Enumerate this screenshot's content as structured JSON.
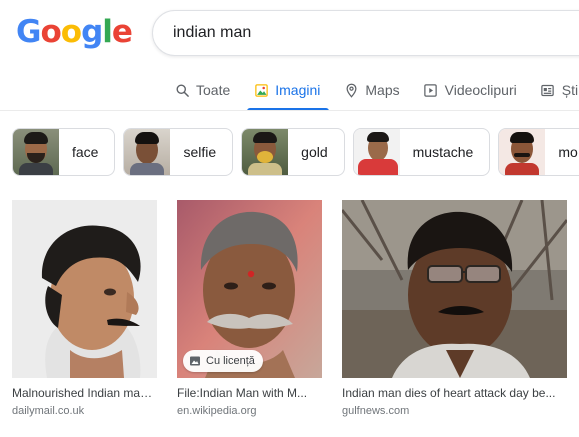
{
  "logo": {
    "letters": [
      "G",
      "o",
      "o",
      "g",
      "l",
      "e"
    ],
    "colors": [
      "#4285f4",
      "#ea4335",
      "#fbbc05",
      "#4285f4",
      "#34a853",
      "#ea4335"
    ]
  },
  "search": {
    "query": "indian man"
  },
  "tabs": [
    {
      "label": "Toate",
      "icon": "search-icon",
      "active": false
    },
    {
      "label": "Imagini",
      "icon": "image-icon",
      "active": true
    },
    {
      "label": "Maps",
      "icon": "map-pin-icon",
      "active": false
    },
    {
      "label": "Videoclipuri",
      "icon": "play-icon",
      "active": false
    },
    {
      "label": "Știri",
      "icon": "news-icon",
      "active": false
    }
  ],
  "chips": [
    {
      "label": "face"
    },
    {
      "label": "selfie"
    },
    {
      "label": "gold"
    },
    {
      "label": "mustache"
    },
    {
      "label": "mo"
    }
  ],
  "results": [
    {
      "title": "Malnourished Indian man ...",
      "source": "dailymail.co.uk",
      "badge": ""
    },
    {
      "title": "File:Indian Man with M...",
      "source": "en.wikipedia.org",
      "badge": "Cu licență"
    },
    {
      "title": "Indian man dies of heart attack day be...",
      "source": "gulfnews.com",
      "badge": ""
    }
  ],
  "colors": {
    "accent": "#1a73e8",
    "tab_inactive": "#5f6368",
    "chip_border": "#dadce0"
  }
}
